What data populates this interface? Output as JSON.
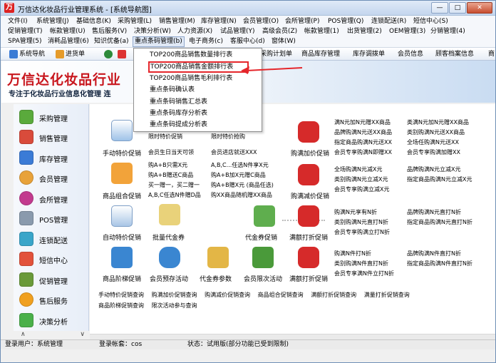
{
  "window": {
    "title": "万信达化妆品行业管理系统 - [系统导航图]",
    "minimize": "—",
    "maximize": "□",
    "close": "✕"
  },
  "menu": {
    "row1": [
      "文件(I)",
      "系统管理(J)",
      "基础信息(K)",
      "采购管理(L)",
      "销售管理(M)",
      "库存管理(N)",
      "会员管理(O)",
      "会所管理(P)",
      "POS管理(Q)",
      "连锁配送(R)",
      "短信中心(S)"
    ],
    "row2": [
      "促销管理(T)",
      "帐款管理(U)",
      "售后服务(V)",
      "决策分析(W)",
      "人力资源(X)",
      "试品管理(Y)",
      "高级会员(Z)",
      "帐款管理(1)",
      "出货管理(2)",
      "OEM管理(3)",
      "分销管理(4)"
    ],
    "row3": [
      "SPA管理(5)",
      "消耗品管理(6)",
      "知识优备(a)",
      "重点条码管理(b)",
      "电子商务(c)",
      "客服中心(d)",
      "窗体(W)"
    ]
  },
  "toolbar": {
    "items": [
      "系统导航",
      "进货单",
      "…",
      "…",
      "…",
      "…",
      "…",
      "采购计划单",
      "商品库存管理",
      "库存调拨单",
      "会员信息",
      "顾客档案信息",
      "商"
    ]
  },
  "banner": {
    "brand": "万信达化妆品行业",
    "slogan": "专注于化妆品行业信息化管理  连"
  },
  "dropdown": {
    "items": [
      "TOP200商品销售数量排行表",
      "TOP200商品销售金额排行表",
      "TOP200商品销售毛利排行表",
      "重点条码确认表",
      "重点条码销售汇总表",
      "重点条码库存分析表",
      "重点条码提成分析表"
    ]
  },
  "sidebar": {
    "items": [
      "采购管理",
      "销售管理",
      "库存管理",
      "会员管理",
      "会所管理",
      "POS管理",
      "连锁配送",
      "短信中心",
      "促销管理",
      "售后服务",
      "决策分析"
    ],
    "scroll_up": "∧",
    "scroll_down": "∨"
  },
  "content": {
    "labels": {
      "l1": "手动特价促销",
      "l2": "商品组合促销",
      "l3": "自动特价促销",
      "l4": "批量代金券",
      "l5": "代金券促销",
      "l6": "满额打折促销",
      "l7": "商品阶梯促销",
      "l8": "会员预存活动",
      "l9": "代金券参数",
      "l10": "会员限次活动",
      "l11": "满额打折促销",
      "l12": "购满加价促销",
      "l13": "购满减价促销"
    },
    "col1": {
      "b1": [
        "限时特价促销",
        "会员生日当天可领"
      ],
      "b2": [
        "购A+B只需X元",
        "购A+B赠送C商品",
        "买一赠一，买二赠一",
        "A,B,C任选N件赠D品"
      ]
    },
    "col2": {
      "b1": [
        "限时特价抢购",
        "会员进店就送XXX"
      ],
      "b2": [
        "A,B,C...任选N件享X元",
        "购A+B加X元赠C商品",
        "购A+B赠X元 (商品任选)",
        "购XX商品随机赠XX商品"
      ]
    },
    "col3": {
      "b1": [
        "满N元加N元赠XX商品",
        "品牌购满N元送XX商品",
        "指定商品购满N元送XX",
        "会员专享购满N即赠XX"
      ],
      "b2": [
        "全场购满N元减X元",
        "类别购满N元立减X元",
        "会员专享购满立减X元"
      ],
      "b3": [
        "购满N元享有N折",
        "类别购满N元直打N折",
        "会员专享购满立打N折"
      ],
      "b4": [
        "购满N件打N折",
        "类别购满N件直打N折",
        "会员专享满N件立打N折"
      ]
    },
    "col4": {
      "b1": [
        "类满N元加N元赠XX商品",
        "类别购满N元送XX商品",
        "全场任购满N元送XX",
        "会员专享购满加赠XX"
      ],
      "b2": [
        "品牌购满N元立减X元",
        "指定商品购满N元立减X元"
      ],
      "b3": [
        "品牌购满N元直打N折",
        "指定商品购满N元直打N折"
      ],
      "b4": [
        "品牌购满N件直打N折",
        "指定商品购满N件直打N折"
      ]
    },
    "links1": [
      "手动特价促销查询",
      "购满加价促销查询",
      "购满减价促销查询",
      "商品组合促销查询",
      "满额打折促销查询",
      "满量打折促销查询"
    ],
    "links2": [
      "商品阶梯促销查询",
      "限次活动参与查询"
    ]
  },
  "status": {
    "user_label": "登录用户：",
    "user": "系统管理",
    "account_label": "登录帐套：",
    "account": "cos",
    "state_label": "状态：",
    "state": "试用版(部分功能已受到限制)"
  },
  "colors": {
    "brand_red": "#c8161d",
    "highlight_red": "#e5262b"
  }
}
